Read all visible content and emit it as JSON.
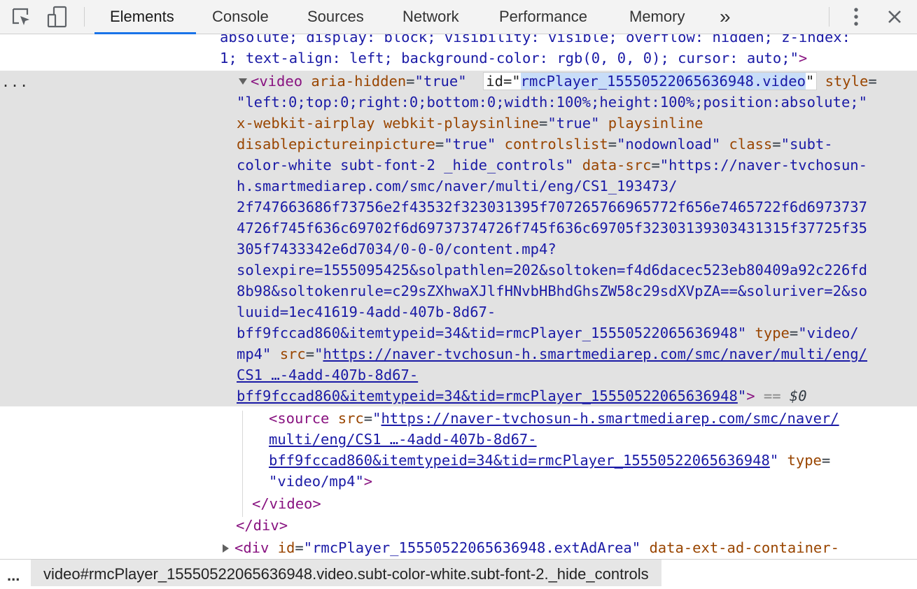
{
  "toolbar": {
    "icons": [
      "inspect-element-icon",
      "device-toolbar-icon",
      "more-tabs-icon",
      "kebab-menu-icon",
      "close-icon"
    ],
    "tabs": [
      {
        "label": "Elements",
        "active": true
      },
      {
        "label": "Console",
        "active": false
      },
      {
        "label": "Sources",
        "active": false
      },
      {
        "label": "Network",
        "active": false
      },
      {
        "label": "Performance",
        "active": false
      },
      {
        "label": "Memory",
        "active": false
      }
    ],
    "more_tabs_glyph": "»"
  },
  "code": {
    "style_line_1": "absolute; display: block; visibility: visible; overflow: hidden; z-index:",
    "style_line_2": "1; text-align: left; background-color: rgb(0, 0, 0); cursor: auto;",
    "ellipsis": "...",
    "video_tag": "video",
    "aria_hidden_name": "aria-hidden",
    "aria_hidden_value": "true",
    "id_name": "id",
    "id_value": "rmcPlayer_15550522065636948.video",
    "style_name": "style",
    "style_value": "left:0;top:0;right:0;bottom:0;width:100%;height:100%;position:absolute;",
    "airplay_name": "x-webkit-airplay",
    "playsinline_webkit_name": "webkit-playsinline",
    "playsinline_webkit_value": "true",
    "playsinline_name": "playsinline",
    "disablepip_name": "disablepictureinpicture",
    "disablepip_value": "true",
    "controlslist_name": "controlslist",
    "controlslist_value": "nodownload",
    "class_name": "class",
    "class_value_1": "subt-",
    "class_value_2": "color-white subt-font-2 _hide_controls",
    "datasrc_name": "data-src",
    "datasrc_1": "https://naver-tvchosun-",
    "datasrc_2": "h.smartmediarep.com/smc/naver/multi/eng/CS1_193473/",
    "datasrc_3": "2f747663686f73756e2f43532f323031395f707265766965772f656e7465722f6d6973737",
    "datasrc_4": "4726f745f636c69702f6d69737374726f745f636c69705f32303139303431315f37725f35",
    "datasrc_5": "305f7433342e6d7034/0-0-0/content.mp4?",
    "datasrc_6": "solexpire=1555095425&solpathlen=202&soltoken=f4d6dacec523eb80409a92c226fd",
    "datasrc_7": "8b98&soltokenrule=c29sZXhwaXJlfHNvbHBhdGhsZW58c29sdXVpZA==&soluriver=2&so",
    "datasrc_8": "luuid=1ec41619-4add-407b-8d67-",
    "datasrc_9": "bff9fccad860&itemtypeid=34&tid=rmcPlayer_15550522065636948",
    "type_name": "type",
    "type_value_1": "video/",
    "type_value_2": "mp4",
    "src_name": "src",
    "src_link_1": "https://naver-tvchosun-h.smartmediarep.com/smc/naver/multi/eng/",
    "src_link_2": "CS1 …-4add-407b-8d67-",
    "src_link_3": "bff9fccad860&itemtypeid=34&tid=rmcPlayer_15550522065636948",
    "eq_marker": "== ",
    "dollar_zero": "$0",
    "source_tag": "source",
    "source_src_1": "https://naver-tvchosun-h.smartmediarep.com/smc/naver/",
    "source_src_2": "multi/eng/CS1 …-4add-407b-8d67-",
    "source_src_3": "bff9fccad860&itemtypeid=34&tid=rmcPlayer_15550522065636948",
    "source_type_value": "video/mp4",
    "close_video": "</video>",
    "close_div": "</div>",
    "div_tag": "div",
    "div_id_value": "rmcPlayer_15550522065636948.extAdArea",
    "div_attr_name": "data-ext-ad-container-"
  },
  "breadcrumb": {
    "ellipsis": "...",
    "item": "video#rmcPlayer_15550522065636948.video.subt-color-white.subt-font-2._hide_controls"
  }
}
